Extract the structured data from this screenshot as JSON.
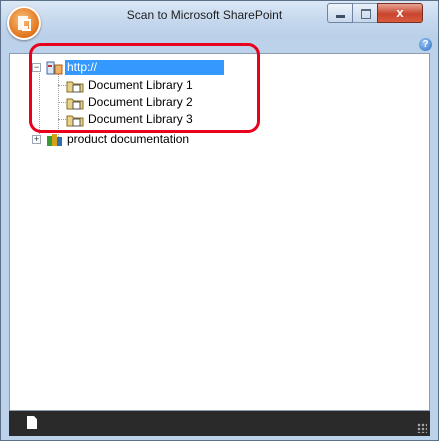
{
  "window": {
    "title": "Scan to Microsoft SharePoint",
    "close_label": "x",
    "help_label": "?"
  },
  "tree": {
    "root": {
      "label": "http://",
      "selected": true
    },
    "children": [
      {
        "label": "Document Library 1"
      },
      {
        "label": "Document Library 2"
      },
      {
        "label": "Document Library 3"
      }
    ],
    "second_root": {
      "label": "product documentation",
      "expander": "+"
    }
  },
  "annotation": {
    "color": "#e8001c"
  }
}
